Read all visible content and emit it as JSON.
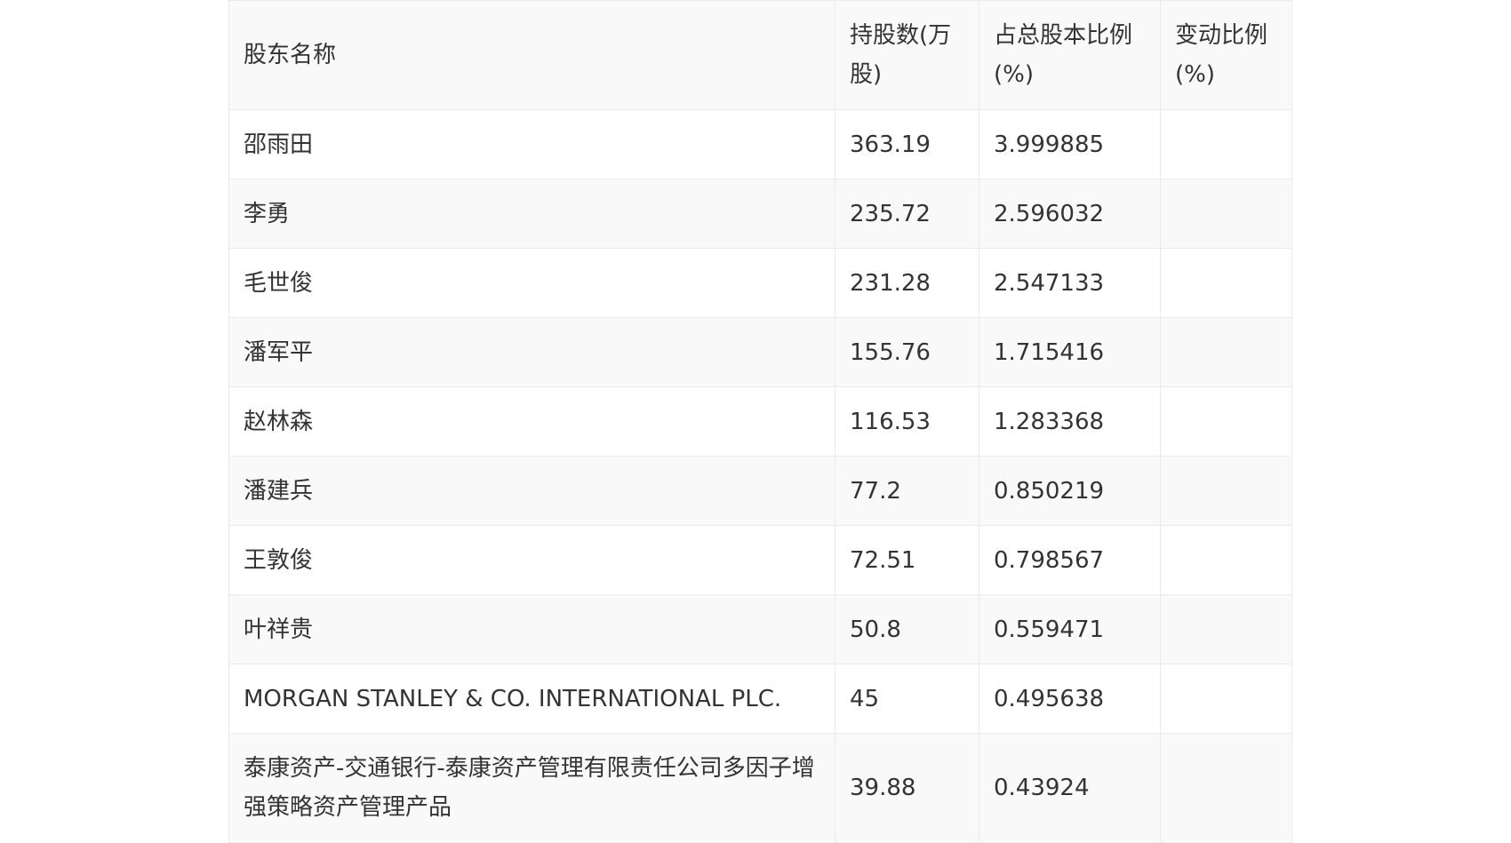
{
  "table": {
    "headers": [
      "股东名称",
      "持股数(万股)",
      "占总股本比例(%)",
      "变动比例(%)"
    ],
    "rows": [
      {
        "name": "邵雨田",
        "shares": "363.19",
        "ratio": "3.999885",
        "change": ""
      },
      {
        "name": "李勇",
        "shares": "235.72",
        "ratio": "2.596032",
        "change": ""
      },
      {
        "name": "毛世俊",
        "shares": "231.28",
        "ratio": "2.547133",
        "change": ""
      },
      {
        "name": "潘军平",
        "shares": "155.76",
        "ratio": "1.715416",
        "change": ""
      },
      {
        "name": "赵林森",
        "shares": "116.53",
        "ratio": "1.283368",
        "change": ""
      },
      {
        "name": "潘建兵",
        "shares": "77.2",
        "ratio": "0.850219",
        "change": ""
      },
      {
        "name": "王敦俊",
        "shares": "72.51",
        "ratio": "0.798567",
        "change": ""
      },
      {
        "name": "叶祥贵",
        "shares": "50.8",
        "ratio": "0.559471",
        "change": ""
      },
      {
        "name": "MORGAN STANLEY & CO. INTERNATIONAL PLC.",
        "shares": "45",
        "ratio": "0.495638",
        "change": ""
      },
      {
        "name": "泰康资产-交通银行-泰康资产管理有限责任公司多因子增强策略资产管理产品",
        "shares": "39.88",
        "ratio": "0.43924",
        "change": ""
      }
    ]
  }
}
